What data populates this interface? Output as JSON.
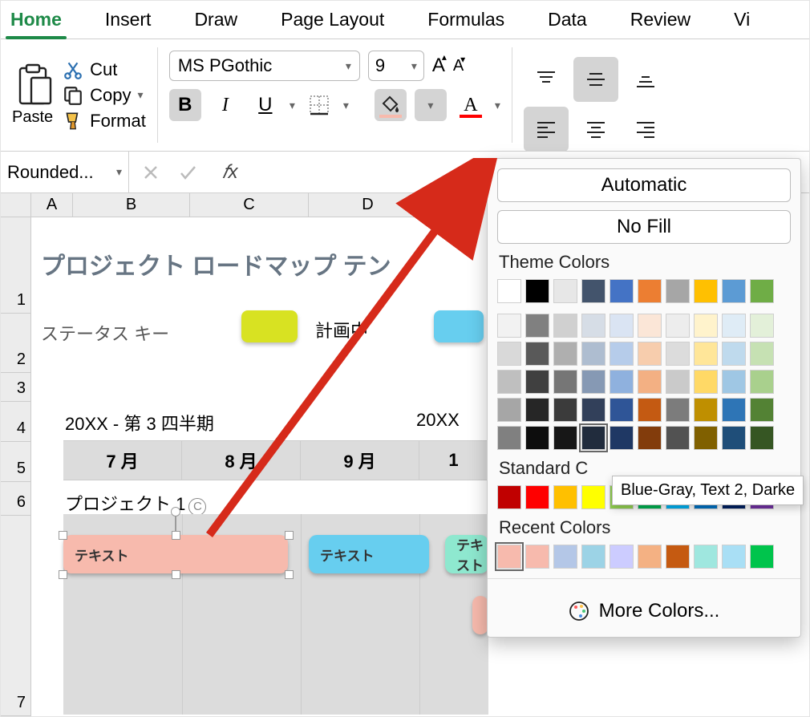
{
  "tabs": {
    "home": "Home",
    "insert": "Insert",
    "draw": "Draw",
    "pagelayout": "Page Layout",
    "formulas": "Formulas",
    "data": "Data",
    "review": "Review",
    "view": "Vi"
  },
  "clipboard": {
    "paste": "Paste",
    "cut": "Cut",
    "copy": "Copy",
    "format": "Format"
  },
  "font": {
    "name": "MS PGothic",
    "size": "9",
    "grow": "A",
    "shrink": "A",
    "bold": "B",
    "italic": "I",
    "underline": "U",
    "fontcolor": "A",
    "chev": "▾"
  },
  "fbar": {
    "name": "Rounded...",
    "fx": "𝑓x"
  },
  "cols": [
    "A",
    "B",
    "C",
    "D"
  ],
  "rows": [
    "1",
    "2",
    "3",
    "4",
    "5",
    "6",
    "7"
  ],
  "sheet": {
    "title": "プロジェクト ロードマップ テン",
    "status_key": "ステータス キー",
    "plan": "計画中",
    "q3": "20XX - 第 3 四半期",
    "q4": "20XX",
    "months": [
      "7 月",
      "8 月",
      "9 月",
      "1"
    ],
    "project": "プロジェクト 1",
    "c": "C",
    "text": "テキスト"
  },
  "popup": {
    "automatic": "Automatic",
    "nofill": "No Fill",
    "theme": "Theme Colors",
    "standard": "Standard C",
    "recent": "Recent Colors",
    "more": "More Colors...",
    "tooltip": "Blue-Gray, Text 2, Darke"
  },
  "colors": {
    "theme_row1": [
      "#ffffff",
      "#000000",
      "#e7e7e7",
      "#43546c",
      "#4473c5",
      "#ec7e32",
      "#a6a6a6",
      "#ffc001",
      "#5c9bd4",
      "#6fad46"
    ],
    "theme_shades": [
      [
        "#f2f2f2",
        "#808080",
        "#d0d0d0",
        "#d6dde6",
        "#dae4f3",
        "#fbe6d7",
        "#ededed",
        "#fff3cc",
        "#dfecf6",
        "#e3f0d9"
      ],
      [
        "#d9d9d9",
        "#595959",
        "#afafaf",
        "#aebdd0",
        "#b6ccea",
        "#f7cdad",
        "#dcdcdc",
        "#ffe699",
        "#bfdaed",
        "#c6e1b3"
      ],
      [
        "#bfbfbf",
        "#404040",
        "#767676",
        "#8699b4",
        "#8fb1de",
        "#f3b083",
        "#cacaca",
        "#ffd966",
        "#9fc7e4",
        "#a9d08d"
      ],
      [
        "#a6a6a6",
        "#262626",
        "#3b3b3b",
        "#32405a",
        "#2f5597",
        "#c45a12",
        "#7c7c7c",
        "#bf8f00",
        "#2e75b6",
        "#538234"
      ],
      [
        "#808080",
        "#0d0d0d",
        "#171717",
        "#212c3d",
        "#1f3864",
        "#823c0c",
        "#525252",
        "#806000",
        "#1f4e79",
        "#365623"
      ]
    ],
    "standard": [
      "#c00000",
      "#ff0000",
      "#ffc000",
      "#ffff00",
      "#92d050",
      "#00b050",
      "#00b0f0",
      "#0070c0",
      "#002060",
      "#7030a0"
    ],
    "recent": [
      "#f7baad",
      "#f7baad",
      "#b4c7e7",
      "#9cd3e6",
      "#ccccff",
      "#f4b183",
      "#c55a11",
      "#9fe7df",
      "#a9dff5",
      "#00c44c"
    ]
  },
  "statusSwatches": {
    "plan": "#d8e222",
    "late": "#67ceef"
  }
}
